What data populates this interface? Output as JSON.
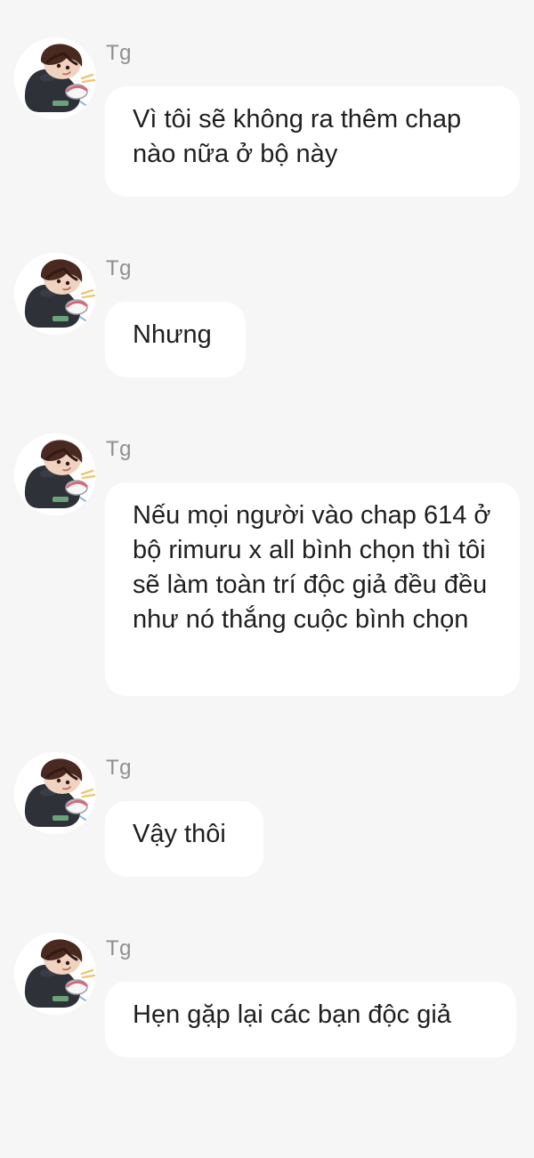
{
  "messages": [
    {
      "sender": "Tg",
      "avatar_icon": "user-avatar-icon",
      "text": "Vì tôi sẽ không ra thêm chap nào nữa ở bộ này"
    },
    {
      "sender": "Tg",
      "avatar_icon": "user-avatar-icon",
      "text": "Nhưng"
    },
    {
      "sender": "Tg",
      "avatar_icon": "user-avatar-icon",
      "text": "Nếu mọi người vào chap 614 ở bộ rimuru x all bình chọn thì tôi sẽ làm toàn trí độc giả đều đều như nó thắng cuộc bình chọn"
    },
    {
      "sender": "Tg",
      "avatar_icon": "user-avatar-icon",
      "text": "Vậy thôi"
    },
    {
      "sender": "Tg",
      "avatar_icon": "user-avatar-icon",
      "text": "Hẹn gặp lại các bạn độc giả"
    }
  ],
  "colors": {
    "background": "#f6f6f6",
    "bubble": "#ffffff",
    "sender_name": "#8f8f8f",
    "message_text": "#1f1f1f"
  }
}
